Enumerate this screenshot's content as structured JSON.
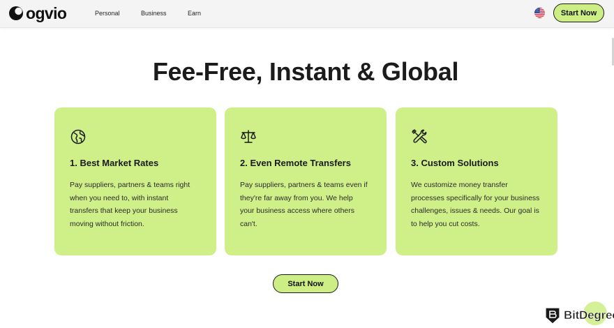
{
  "header": {
    "brand": "ogvio",
    "nav": [
      {
        "label": "Personal"
      },
      {
        "label": "Business"
      },
      {
        "label": "Earn"
      }
    ],
    "cta_label": "Start Now"
  },
  "main": {
    "headline": "Fee-Free, Instant & Global",
    "cards": [
      {
        "icon": "globe-icon",
        "title": "1. Best Market Rates",
        "body_lines": [
          "Pay suppliers, partners & teams right",
          "when you need to, with instant",
          "transfers that keep your business",
          "moving without friction."
        ]
      },
      {
        "icon": "scales-icon",
        "title": "2. Even Remote Transfers",
        "body_lines": [
          "Pay suppliers, partners & teams even if",
          "they're far away from you. We help",
          "your business access where others",
          "can't."
        ]
      },
      {
        "icon": "tools-icon",
        "title": "3. Custom Solutions",
        "body_lines": [
          "We customize money transfer",
          "processes specifically for your business",
          "challenges, issues & needs. Our goal is",
          "to help you cut costs."
        ]
      }
    ],
    "cta_label": "Start Now"
  },
  "watermark": {
    "text": "BitDegree"
  },
  "colors": {
    "accent": "#cdee85",
    "card": "#cfef88",
    "header_bg": "#f3f4f3",
    "text": "#1b1b1b"
  }
}
